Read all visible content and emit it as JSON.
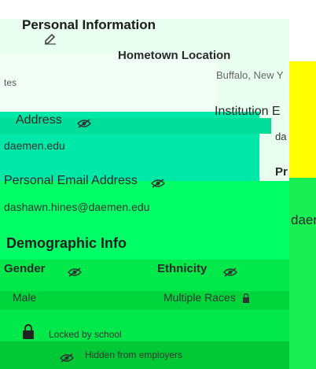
{
  "header": {
    "title": "Personal Information"
  },
  "hometown": {
    "label": "Hometown Location",
    "value": "Buffalo, New Y"
  },
  "institution": {
    "label": "Institution E",
    "value_fragment": "da",
    "extra_label": "Pr",
    "extra_word": "daem"
  },
  "left_fragment": "tes",
  "school_email": {
    "label": "Address",
    "value": "daemen.edu"
  },
  "personal_email": {
    "label": "Personal Email Address",
    "value": "dashawn.hines@daemen.edu"
  },
  "demographic": {
    "heading": "Demographic Info",
    "gender_label": "Gender",
    "gender_value": "Male",
    "ethnicity_label": "Ethnicity",
    "ethnicity_value": "Multiple Races"
  },
  "legend": {
    "locked_text": "Locked by school",
    "hidden_text": "Hidden from employers"
  },
  "colors": {
    "green": "#00ff66",
    "teal": "#00e8a8",
    "yellow": "#ffff00",
    "dark_green": "#00cc33"
  }
}
